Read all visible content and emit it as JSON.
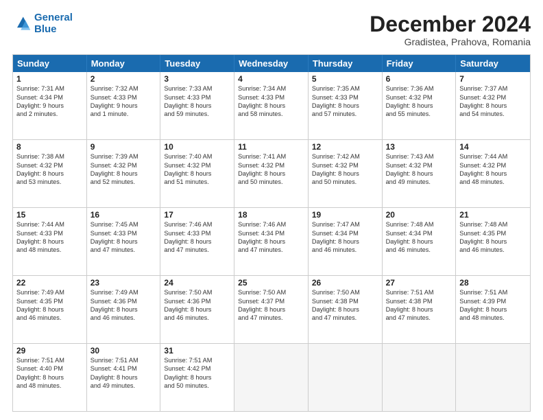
{
  "logo": {
    "line1": "General",
    "line2": "Blue"
  },
  "title": "December 2024",
  "location": "Gradistea, Prahova, Romania",
  "header_days": [
    "Sunday",
    "Monday",
    "Tuesday",
    "Wednesday",
    "Thursday",
    "Friday",
    "Saturday"
  ],
  "weeks": [
    [
      {
        "day": "1",
        "lines": [
          "Sunrise: 7:31 AM",
          "Sunset: 4:34 PM",
          "Daylight: 9 hours",
          "and 2 minutes."
        ]
      },
      {
        "day": "2",
        "lines": [
          "Sunrise: 7:32 AM",
          "Sunset: 4:33 PM",
          "Daylight: 9 hours",
          "and 1 minute."
        ]
      },
      {
        "day": "3",
        "lines": [
          "Sunrise: 7:33 AM",
          "Sunset: 4:33 PM",
          "Daylight: 8 hours",
          "and 59 minutes."
        ]
      },
      {
        "day": "4",
        "lines": [
          "Sunrise: 7:34 AM",
          "Sunset: 4:33 PM",
          "Daylight: 8 hours",
          "and 58 minutes."
        ]
      },
      {
        "day": "5",
        "lines": [
          "Sunrise: 7:35 AM",
          "Sunset: 4:33 PM",
          "Daylight: 8 hours",
          "and 57 minutes."
        ]
      },
      {
        "day": "6",
        "lines": [
          "Sunrise: 7:36 AM",
          "Sunset: 4:32 PM",
          "Daylight: 8 hours",
          "and 55 minutes."
        ]
      },
      {
        "day": "7",
        "lines": [
          "Sunrise: 7:37 AM",
          "Sunset: 4:32 PM",
          "Daylight: 8 hours",
          "and 54 minutes."
        ]
      }
    ],
    [
      {
        "day": "8",
        "lines": [
          "Sunrise: 7:38 AM",
          "Sunset: 4:32 PM",
          "Daylight: 8 hours",
          "and 53 minutes."
        ]
      },
      {
        "day": "9",
        "lines": [
          "Sunrise: 7:39 AM",
          "Sunset: 4:32 PM",
          "Daylight: 8 hours",
          "and 52 minutes."
        ]
      },
      {
        "day": "10",
        "lines": [
          "Sunrise: 7:40 AM",
          "Sunset: 4:32 PM",
          "Daylight: 8 hours",
          "and 51 minutes."
        ]
      },
      {
        "day": "11",
        "lines": [
          "Sunrise: 7:41 AM",
          "Sunset: 4:32 PM",
          "Daylight: 8 hours",
          "and 50 minutes."
        ]
      },
      {
        "day": "12",
        "lines": [
          "Sunrise: 7:42 AM",
          "Sunset: 4:32 PM",
          "Daylight: 8 hours",
          "and 50 minutes."
        ]
      },
      {
        "day": "13",
        "lines": [
          "Sunrise: 7:43 AM",
          "Sunset: 4:32 PM",
          "Daylight: 8 hours",
          "and 49 minutes."
        ]
      },
      {
        "day": "14",
        "lines": [
          "Sunrise: 7:44 AM",
          "Sunset: 4:32 PM",
          "Daylight: 8 hours",
          "and 48 minutes."
        ]
      }
    ],
    [
      {
        "day": "15",
        "lines": [
          "Sunrise: 7:44 AM",
          "Sunset: 4:33 PM",
          "Daylight: 8 hours",
          "and 48 minutes."
        ]
      },
      {
        "day": "16",
        "lines": [
          "Sunrise: 7:45 AM",
          "Sunset: 4:33 PM",
          "Daylight: 8 hours",
          "and 47 minutes."
        ]
      },
      {
        "day": "17",
        "lines": [
          "Sunrise: 7:46 AM",
          "Sunset: 4:33 PM",
          "Daylight: 8 hours",
          "and 47 minutes."
        ]
      },
      {
        "day": "18",
        "lines": [
          "Sunrise: 7:46 AM",
          "Sunset: 4:34 PM",
          "Daylight: 8 hours",
          "and 47 minutes."
        ]
      },
      {
        "day": "19",
        "lines": [
          "Sunrise: 7:47 AM",
          "Sunset: 4:34 PM",
          "Daylight: 8 hours",
          "and 46 minutes."
        ]
      },
      {
        "day": "20",
        "lines": [
          "Sunrise: 7:48 AM",
          "Sunset: 4:34 PM",
          "Daylight: 8 hours",
          "and 46 minutes."
        ]
      },
      {
        "day": "21",
        "lines": [
          "Sunrise: 7:48 AM",
          "Sunset: 4:35 PM",
          "Daylight: 8 hours",
          "and 46 minutes."
        ]
      }
    ],
    [
      {
        "day": "22",
        "lines": [
          "Sunrise: 7:49 AM",
          "Sunset: 4:35 PM",
          "Daylight: 8 hours",
          "and 46 minutes."
        ]
      },
      {
        "day": "23",
        "lines": [
          "Sunrise: 7:49 AM",
          "Sunset: 4:36 PM",
          "Daylight: 8 hours",
          "and 46 minutes."
        ]
      },
      {
        "day": "24",
        "lines": [
          "Sunrise: 7:50 AM",
          "Sunset: 4:36 PM",
          "Daylight: 8 hours",
          "and 46 minutes."
        ]
      },
      {
        "day": "25",
        "lines": [
          "Sunrise: 7:50 AM",
          "Sunset: 4:37 PM",
          "Daylight: 8 hours",
          "and 47 minutes."
        ]
      },
      {
        "day": "26",
        "lines": [
          "Sunrise: 7:50 AM",
          "Sunset: 4:38 PM",
          "Daylight: 8 hours",
          "and 47 minutes."
        ]
      },
      {
        "day": "27",
        "lines": [
          "Sunrise: 7:51 AM",
          "Sunset: 4:38 PM",
          "Daylight: 8 hours",
          "and 47 minutes."
        ]
      },
      {
        "day": "28",
        "lines": [
          "Sunrise: 7:51 AM",
          "Sunset: 4:39 PM",
          "Daylight: 8 hours",
          "and 48 minutes."
        ]
      }
    ],
    [
      {
        "day": "29",
        "lines": [
          "Sunrise: 7:51 AM",
          "Sunset: 4:40 PM",
          "Daylight: 8 hours",
          "and 48 minutes."
        ]
      },
      {
        "day": "30",
        "lines": [
          "Sunrise: 7:51 AM",
          "Sunset: 4:41 PM",
          "Daylight: 8 hours",
          "and 49 minutes."
        ]
      },
      {
        "day": "31",
        "lines": [
          "Sunrise: 7:51 AM",
          "Sunset: 4:42 PM",
          "Daylight: 8 hours",
          "and 50 minutes."
        ]
      },
      {
        "day": "",
        "lines": []
      },
      {
        "day": "",
        "lines": []
      },
      {
        "day": "",
        "lines": []
      },
      {
        "day": "",
        "lines": []
      }
    ]
  ]
}
